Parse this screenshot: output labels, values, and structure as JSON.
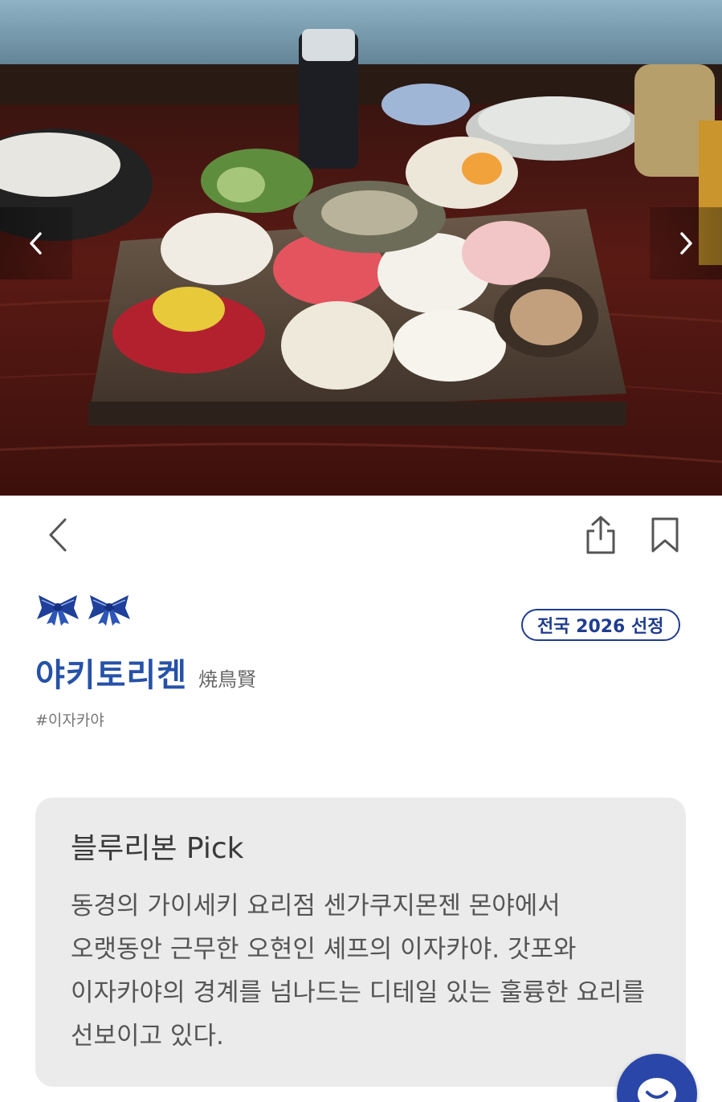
{
  "hero": {
    "prev_icon": "chevron-left-icon",
    "next_icon": "chevron-right-icon"
  },
  "toolbar": {
    "back_icon": "chevron-left-icon",
    "share_icon": "share-icon",
    "bookmark_icon": "bookmark-icon"
  },
  "restaurant": {
    "ribbon_count": 2,
    "ribbon_icon": "blue-ribbon-icon",
    "badge": "전국 2026 선정",
    "name": "야키토리켄",
    "name_original": "焼鳥賢",
    "hashtag": "#이자카야"
  },
  "pick": {
    "title": "블루리본 Pick",
    "body": "동경의 가이세키 요리점 센가쿠지몬젠 몬야에서 오랫동안 근무한 오현인 셰프의 이자카야. 갓포와 이자카야의 경계를 넘나드는 디테일 있는 훌륭한 요리를 선보이고 있다."
  },
  "chat": {
    "icon": "chat-icon"
  },
  "colors": {
    "brand_blue": "#2651a8",
    "badge_blue": "#1f3d8f",
    "card_bg": "#ebebeb",
    "fab_blue": "#2a46a8"
  }
}
